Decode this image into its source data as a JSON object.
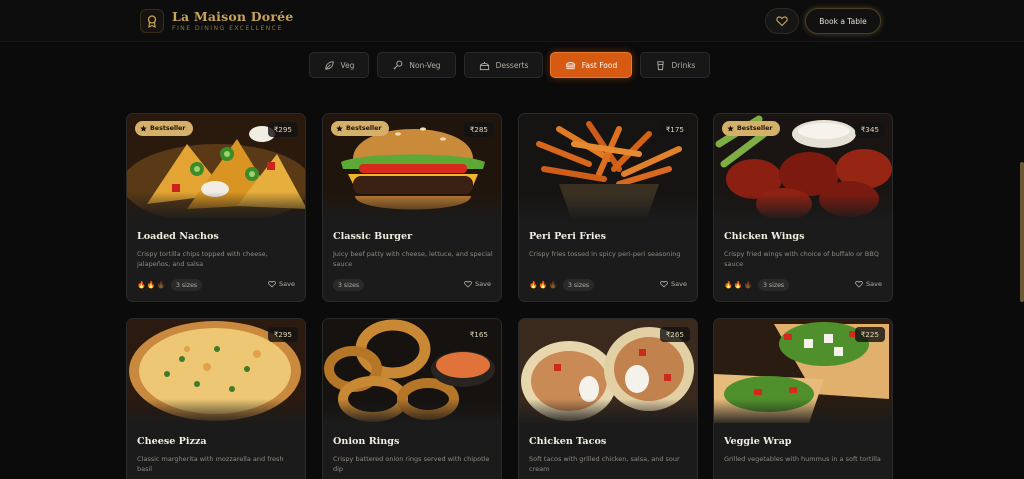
{
  "brand": {
    "name": "La Maison Dorée",
    "tagline": "FINE DINING EXCELLENCE"
  },
  "header": {
    "book_label": "Book a Table",
    "heart_icon": "heart-icon",
    "logo_icon": "medal-icon"
  },
  "colors": {
    "accent": "#c8a35a",
    "active_tab": "#d65a12",
    "badge": "#d5b06a",
    "background": "#0b0b0b"
  },
  "tabs": [
    {
      "label": "Veg",
      "icon": "leaf-icon",
      "active": false
    },
    {
      "label": "Non-Veg",
      "icon": "drumstick-icon",
      "active": false
    },
    {
      "label": "Desserts",
      "icon": "cake-icon",
      "active": false
    },
    {
      "label": "Fast Food",
      "icon": "burger-icon",
      "active": true
    },
    {
      "label": "Drinks",
      "icon": "cup-icon",
      "active": false
    }
  ],
  "items": [
    {
      "title": "Loaded Nachos",
      "desc": "Crispy tortilla chips topped with cheese, jalapeños, and salsa",
      "price": "₹295",
      "badge": "Bestseller",
      "sizes": "3 sizes",
      "save": "Save",
      "spice": 2
    },
    {
      "title": "Classic Burger",
      "desc": "Juicy beef patty with cheese, lettuce, and special sauce",
      "price": "₹285",
      "badge": "Bestseller",
      "sizes": "3 sizes",
      "save": "Save",
      "spice": 0
    },
    {
      "title": "Peri Peri Fries",
      "desc": "Crispy fries tossed in spicy peri-peri seasoning",
      "price": "₹175",
      "badge": "",
      "sizes": "3 sizes",
      "save": "Save",
      "spice": 2
    },
    {
      "title": "Chicken Wings",
      "desc": "Crispy fried wings with choice of buffalo or BBQ sauce",
      "price": "₹345",
      "badge": "Bestseller",
      "sizes": "3 sizes",
      "save": "Save",
      "spice": 2
    },
    {
      "title": "Cheese Pizza",
      "desc": "Classic margherita with mozzarella and fresh basil",
      "price": "₹295",
      "badge": ""
    },
    {
      "title": "Onion Rings",
      "desc": "Crispy battered onion rings served with chipotle dip",
      "price": "₹165",
      "badge": ""
    },
    {
      "title": "Chicken Tacos",
      "desc": "Soft tacos with grilled chicken, salsa, and sour cream",
      "price": "₹265",
      "badge": ""
    },
    {
      "title": "Veggie Wrap",
      "desc": "Grilled vegetables with hummus in a soft tortilla",
      "price": "₹225",
      "badge": ""
    }
  ]
}
